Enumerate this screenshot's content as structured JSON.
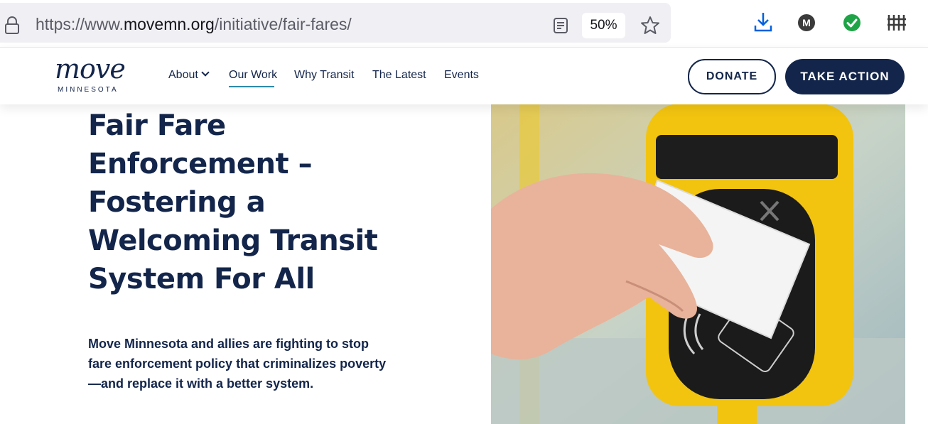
{
  "browser": {
    "url_prefix": "https://www.",
    "url_domain": "movemn.org",
    "url_path": "/initiative/fair-fares/",
    "zoom": "50%",
    "profile_initial": "M"
  },
  "header": {
    "logo_text": "move",
    "logo_subtext": "MINNESOTA",
    "nav": [
      {
        "label": "About"
      },
      {
        "label": "Our Work"
      },
      {
        "label": "Why Transit"
      },
      {
        "label": "The Latest"
      },
      {
        "label": "Events"
      }
    ],
    "donate_label": "DONATE",
    "action_label": "TAKE ACTION"
  },
  "hero": {
    "title_lines": [
      "Fair Fare",
      "Enforcement –",
      "Fostering a",
      "Welcoming Transit",
      "System For All"
    ],
    "description": "Move Minnesota and allies are fighting to stop fare enforcement policy that criminalizes poverty—and replace it with a better system."
  },
  "colors": {
    "navy": "#13254a",
    "underline": "#2c8aa8",
    "validator_yellow": "#f2c410"
  }
}
